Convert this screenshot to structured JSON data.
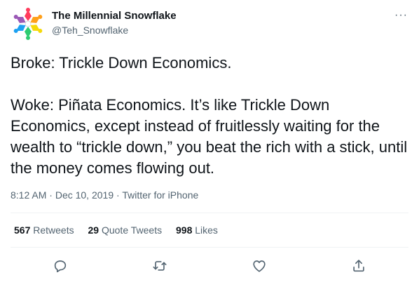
{
  "author": {
    "name": "The Millennial Snowflake",
    "handle": "@Teh_Snowflake"
  },
  "more_label": "···",
  "tweet": {
    "paragraph1": "Broke: Trickle Down Economics.",
    "paragraph2": "Woke: Piñata Economics. It’s like Trickle Down Economics, except instead of fruitlessly waiting for the wealth to “trickle down,” you beat the rich with a stick, until the money comes flowing out."
  },
  "meta": {
    "time": "8:12 AM",
    "separator": " · ",
    "date": "Dec 10, 2019",
    "source": "Twitter for iPhone"
  },
  "stats": {
    "retweets_count": "567",
    "retweets_label": "Retweets",
    "quotes_count": "29",
    "quotes_label": "Quote Tweets",
    "likes_count": "998",
    "likes_label": "Likes"
  },
  "actions": [
    "reply-icon",
    "retweet-icon",
    "like-icon",
    "share-icon"
  ],
  "colors": {
    "text": "#0f1419",
    "secondary": "#536471",
    "divider": "#eff3f4",
    "icon": "#536471"
  }
}
